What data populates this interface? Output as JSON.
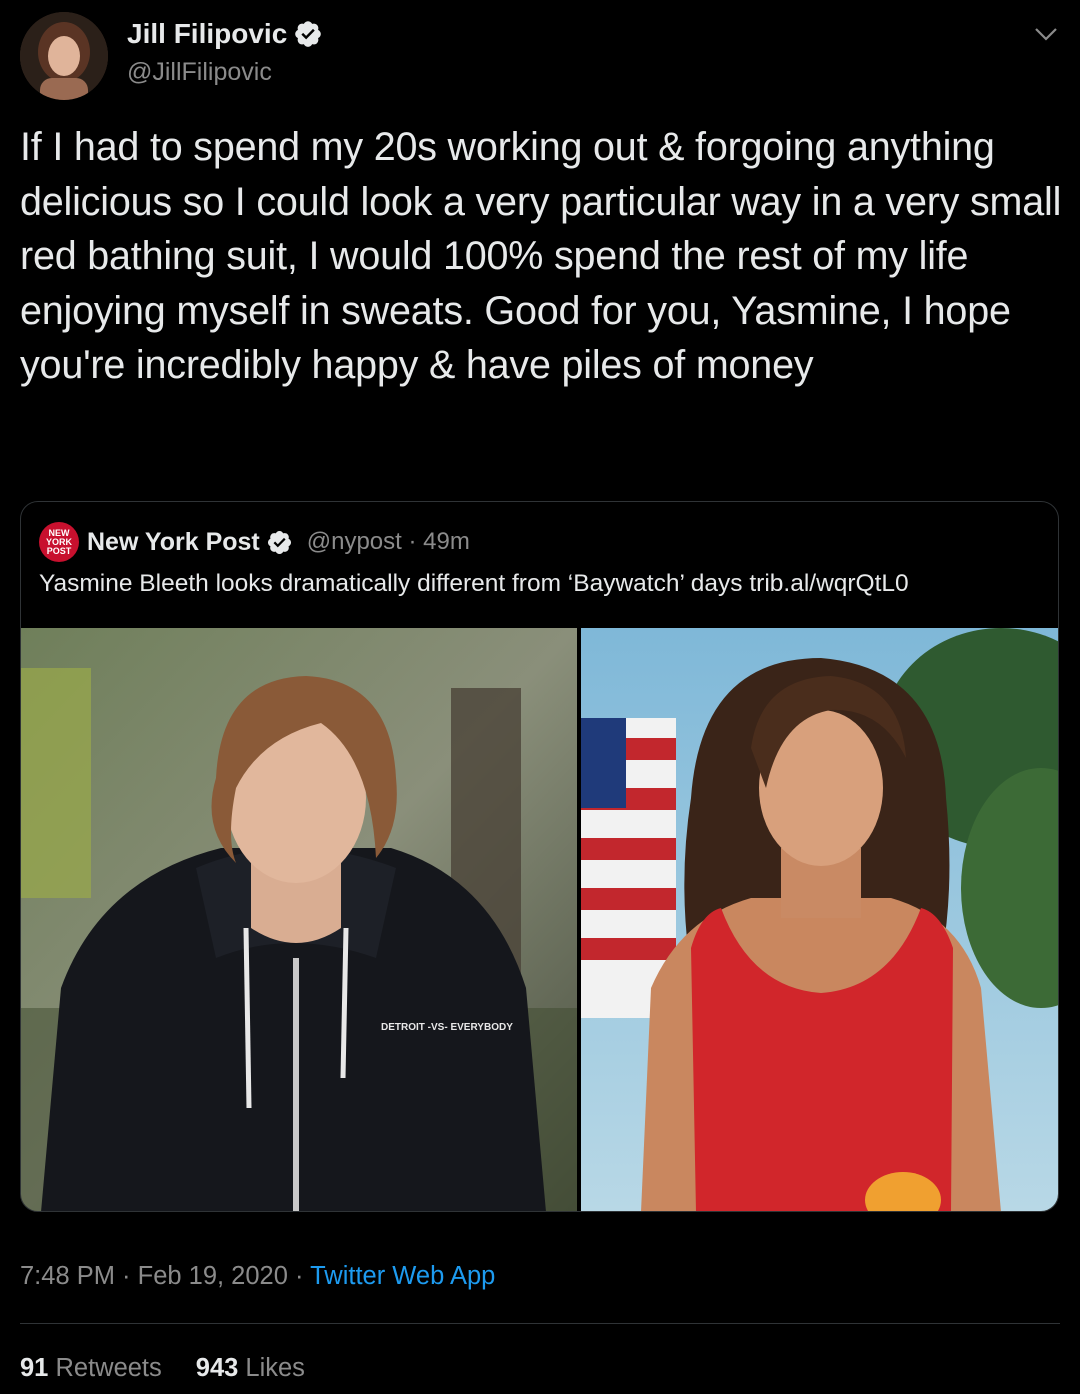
{
  "author": {
    "name": "Jill Filipovic",
    "handle": "@JillFilipovic",
    "verified": true
  },
  "tweet_text": "If I had to spend my 20s working out & forgoing anything delicious so I could look a very particular way in a very small red bathing suit, I would 100% spend the rest of my life enjoying myself in sweats. Good for you, Yasmine, I hope you're incredibly happy & have piles of money",
  "quoted_tweet": {
    "name": "New York Post",
    "logo_text": "NEW YORK POST",
    "meta": "@nypost · 49m",
    "text": "Yasmine Bleeth looks dramatically different from ‘Baywatch’ days trib.al/wqrQtL0",
    "hoodie_text": "DETROIT -VS- EVERYBODY"
  },
  "timestamp": "7:48 PM · Feb 19, 2020 · ",
  "source": "Twitter Web App",
  "stats": {
    "retweets_count": "91",
    "retweets_label": "Retweets",
    "likes_count": "943",
    "likes_label": "Likes"
  },
  "colors": {
    "background": "#000000",
    "link": "#1d9bf0",
    "verified": "#ffffff",
    "nypost_red": "#c8102e"
  }
}
